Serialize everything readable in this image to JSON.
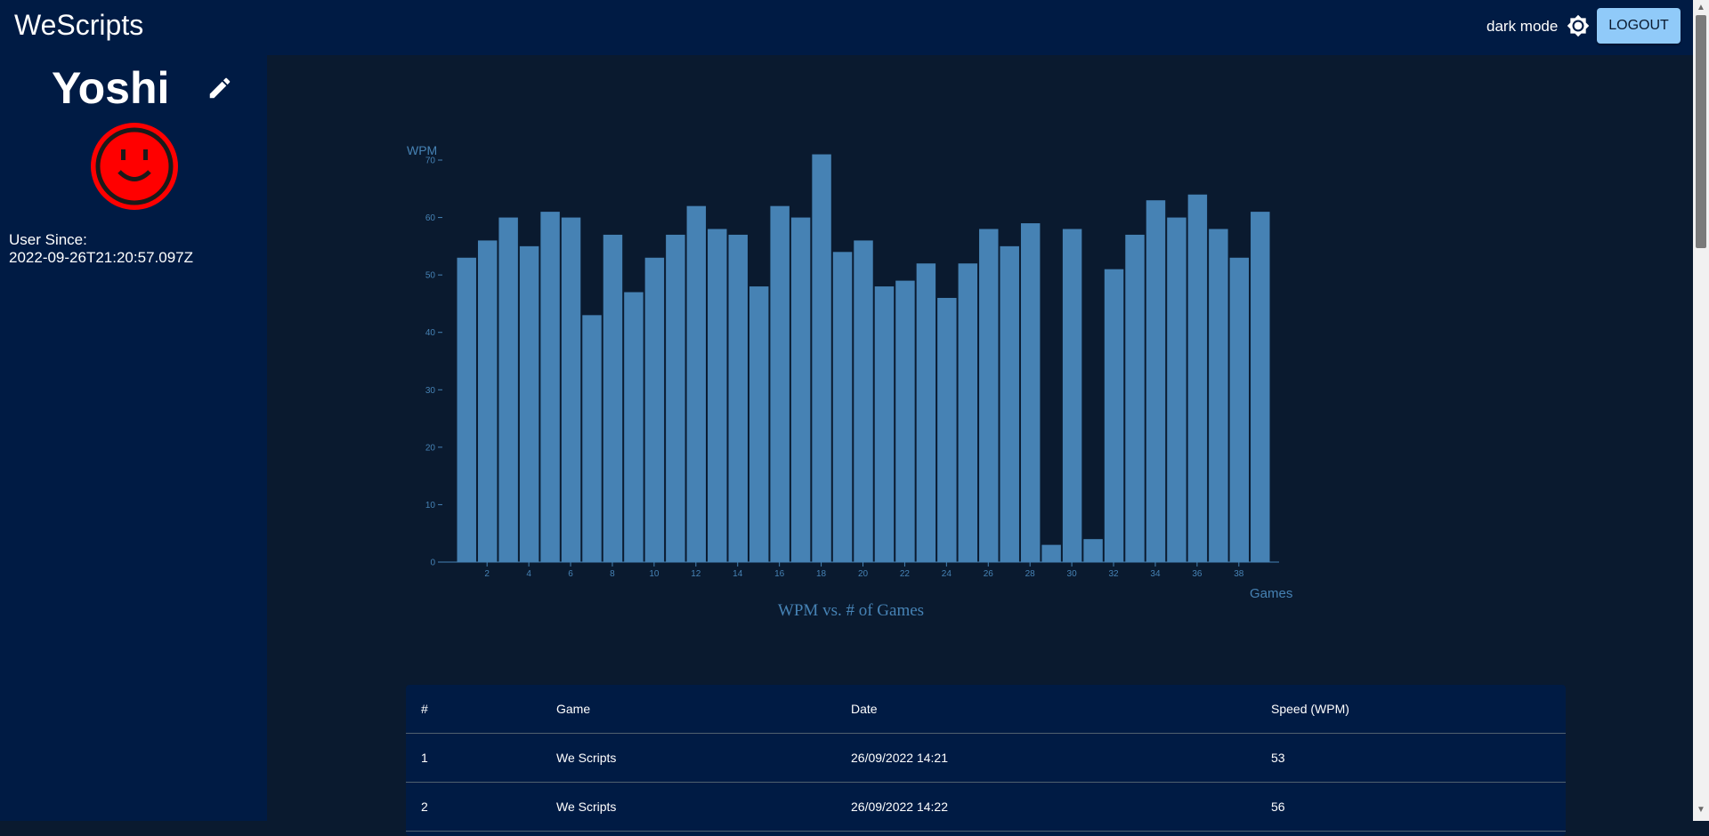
{
  "header": {
    "brand": "WeScripts",
    "dark_mode_label": "dark mode",
    "logout_label": "LOGOUT"
  },
  "profile": {
    "username": "Yoshi",
    "user_since_label": "User Since:",
    "user_since_value": "2022-09-26T21:20:57.097Z",
    "avatar_color": "#ff0000"
  },
  "colors": {
    "bar": "#4682b4",
    "axis": "#4682b4",
    "background": "#0a1a2f",
    "panel": "#001b44"
  },
  "chart_data": {
    "type": "bar",
    "title": "WPM vs. # of Games",
    "xlabel": "Games",
    "ylabel": "WPM",
    "ylim": [
      0,
      70
    ],
    "yticks": [
      0,
      10,
      20,
      30,
      40,
      50,
      60,
      70
    ],
    "xticks": [
      2,
      4,
      6,
      8,
      10,
      12,
      14,
      16,
      18,
      20,
      22,
      24,
      26,
      28,
      30,
      32,
      34,
      36,
      38
    ],
    "categories": [
      1,
      2,
      3,
      4,
      5,
      6,
      7,
      8,
      9,
      10,
      11,
      12,
      13,
      14,
      15,
      16,
      17,
      18,
      19,
      20,
      21,
      22,
      23,
      24,
      25,
      26,
      27,
      28,
      29,
      30,
      31,
      32,
      33,
      34,
      35,
      36,
      37,
      38,
      39
    ],
    "values": [
      53,
      56,
      60,
      55,
      61,
      60,
      43,
      57,
      47,
      53,
      57,
      62,
      58,
      57,
      48,
      62,
      60,
      71,
      54,
      56,
      48,
      49,
      52,
      46,
      52,
      58,
      55,
      59,
      3,
      58,
      4,
      51,
      57,
      63,
      60,
      64,
      58,
      53,
      61
    ],
    "grid": false,
    "legend": "none"
  },
  "table": {
    "headers": [
      "#",
      "Game",
      "Date",
      "Speed (WPM)"
    ],
    "rows": [
      [
        "1",
        "We Scripts",
        "26/09/2022 14:21",
        "53"
      ],
      [
        "2",
        "We Scripts",
        "26/09/2022 14:22",
        "56"
      ]
    ]
  }
}
